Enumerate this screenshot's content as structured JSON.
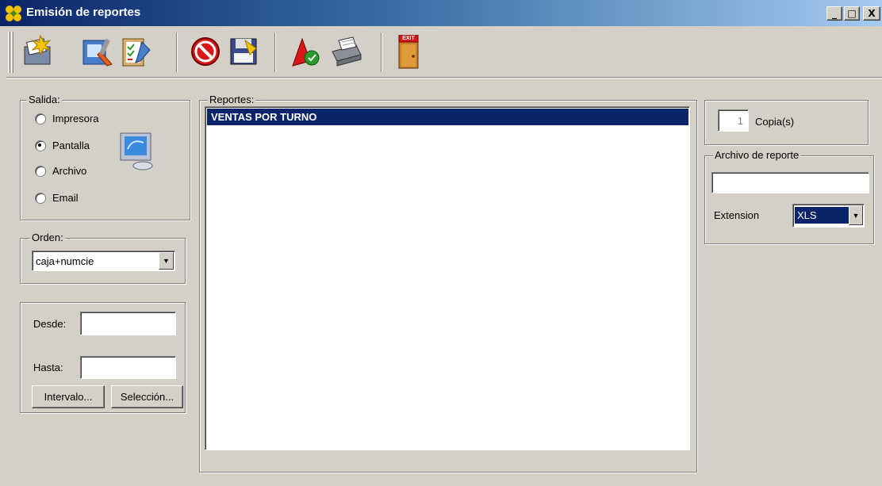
{
  "window": {
    "title": "Emisión de reportes",
    "controls": [
      "_",
      "□",
      "X"
    ]
  },
  "toolbar": {
    "buttons": [
      {
        "icon": "generate-report-icon"
      },
      {
        "icon": "design-tools-icon"
      },
      {
        "icon": "checklist-edit-icon"
      },
      {
        "icon": "cancel-icon"
      },
      {
        "icon": "save-disk-icon"
      },
      {
        "icon": "filter-icon"
      },
      {
        "icon": "printer-icon"
      },
      {
        "icon": "exit-door-icon",
        "label": "EXIT"
      }
    ]
  },
  "salida": {
    "legend": "Salida:",
    "options": [
      {
        "label": "Impresora",
        "checked": false
      },
      {
        "label": "Pantalla",
        "checked": true
      },
      {
        "label": "Archivo",
        "checked": false
      },
      {
        "label": "Email",
        "checked": false
      }
    ]
  },
  "orden": {
    "legend": "Orden:",
    "value": "caja+numcie"
  },
  "rango": {
    "desde_label": "Desde:",
    "desde_value": "",
    "hasta_label": "Hasta:",
    "hasta_value": "",
    "intervalo_label": "Intervalo...",
    "seleccion_label": "Selección..."
  },
  "reportes": {
    "legend": "Reportes:",
    "items": [
      "VENTAS POR TURNO"
    ],
    "selected_index": 0
  },
  "copias": {
    "value": "1",
    "label": "Copia(s)"
  },
  "archivo": {
    "legend": "Archivo de reporte",
    "value": "",
    "extension_label": "Extension",
    "extension_value": "XLS"
  },
  "colors": {
    "title_start": "#0a246a",
    "title_end": "#a6caf0",
    "face": "#d4d0c8",
    "selection": "#0a246a"
  }
}
